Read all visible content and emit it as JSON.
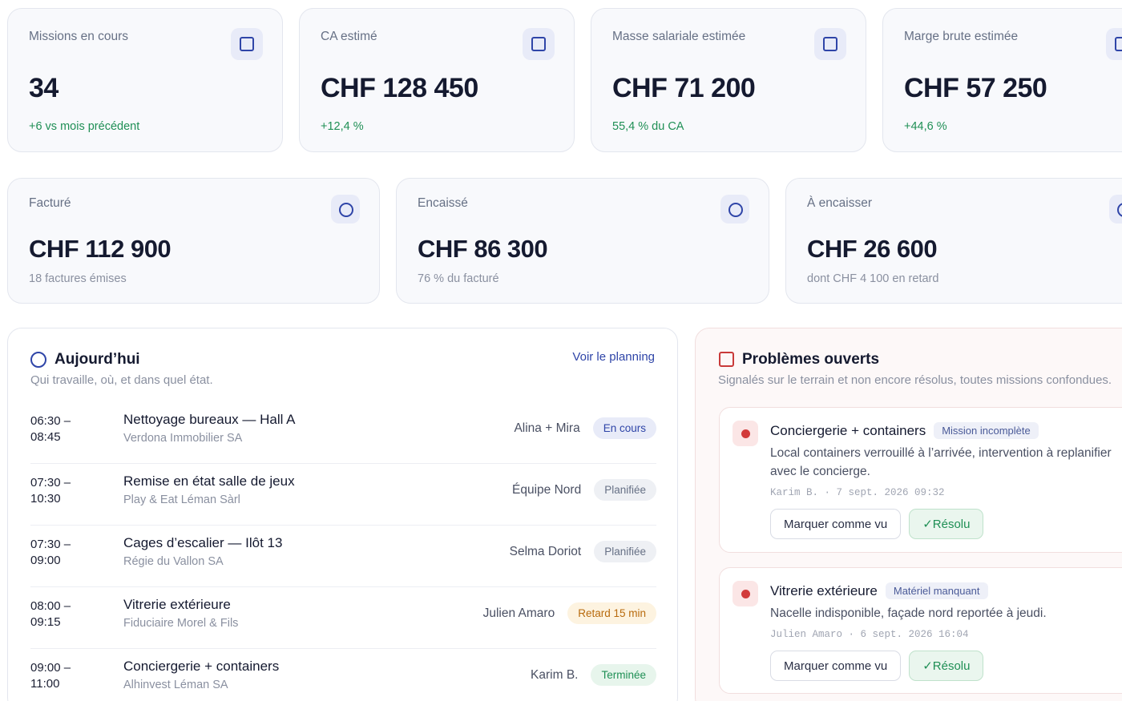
{
  "kpis_top": [
    {
      "label": "Missions en cours",
      "value": "34",
      "sub": "+6 vs mois précédent"
    },
    {
      "label": "CA estimé",
      "value": "CHF 128 450",
      "sub": "+12,4 %"
    },
    {
      "label": "Masse salariale estimée",
      "value": "CHF 71 200",
      "sub": "55,4 % du CA"
    },
    {
      "label": "Marge brute estimée",
      "value": "CHF 57 250",
      "sub": "+44,6 %"
    }
  ],
  "kpis_bottom": [
    {
      "label": "Facturé",
      "value": "CHF 112 900",
      "sub": "18 factures émises"
    },
    {
      "label": "Encaissé",
      "value": "CHF 86 300",
      "sub": "76 % du facturé"
    },
    {
      "label": "À encaisser",
      "value": "CHF 26 600",
      "sub": "dont CHF 4 100 en retard"
    }
  ],
  "today": {
    "title": "Aujourd’hui",
    "subtitle": "Qui travaille, où, et dans quel état.",
    "link": "Voir le planning",
    "rows": [
      {
        "time": "06:30 –\n08:45",
        "title": "Nettoyage bureaux — Hall A",
        "client": "Verdona Immobilier SA",
        "who": "Alina + Mira",
        "status": "En cours"
      },
      {
        "time": "07:30 –\n10:30",
        "title": "Remise en état salle de jeux",
        "client": "Play & Eat Léman Sàrl",
        "who": "Équipe Nord",
        "status": "Planifiée"
      },
      {
        "time": "07:30 –\n09:00",
        "title": "Cages d’escalier — Ilôt 13",
        "client": "Régie du Vallon SA",
        "who": "Selma Doriot",
        "status": "Planifiée"
      },
      {
        "time": "08:00 –\n09:15",
        "title": "Vitrerie extérieure",
        "client": "Fiduciaire Morel & Fils",
        "who": "Julien Amaro",
        "status": "Retard 15 min"
      },
      {
        "time": "09:00 –\n11:00",
        "title": "Conciergerie + containers",
        "client": "Alhinvest Léman SA",
        "who": "Karim B.",
        "status": "Terminée"
      }
    ]
  },
  "issues": {
    "title": "Problèmes ouverts",
    "subtitle": "Signalés sur le terrain et non encore résolus, toutes missions confondues.",
    "items": [
      {
        "title": "Conciergerie + containers",
        "tag": "Mission incomplète",
        "desc": "Local containers verrouillé à l’arrivée, intervention à replanifier avec le concierge.",
        "meta": "Karim B. · 7 sept. 2026 09:32",
        "btn_seen": "Marquer comme vu",
        "btn_resolved": "✓Résolu"
      },
      {
        "title": "Vitrerie extérieure",
        "tag": "Matériel manquant",
        "desc": "Nacelle indisponible, façade nord reportée à jeudi.",
        "meta": "Julien Amaro · 6 sept. 2026 16:04",
        "btn_seen": "Marquer comme vu",
        "btn_resolved": "✓Résolu"
      }
    ]
  },
  "colors": {
    "accent": "#2f45a8",
    "positive": "#1f8f55",
    "danger": "#d23b3b",
    "warning": "#b86a0c"
  }
}
